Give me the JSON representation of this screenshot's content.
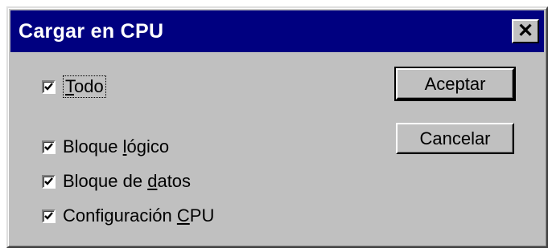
{
  "dialog": {
    "title": "Cargar en CPU",
    "close_symbol": "✕",
    "checkboxes": [
      {
        "label_pre": "",
        "label_key": "T",
        "label_post": "odo",
        "mnemonic": "T",
        "checked": true
      },
      {
        "label_pre": "Bloque ",
        "label_key": "l",
        "label_post": "ógico",
        "mnemonic": "l",
        "checked": true
      },
      {
        "label_pre": "Bloque de ",
        "label_key": "d",
        "label_post": "atos",
        "mnemonic": "d",
        "checked": true
      },
      {
        "label_pre": "Configuración ",
        "label_key": "C",
        "label_post": "PU",
        "mnemonic": "C",
        "checked": true
      }
    ],
    "buttons": {
      "accept": "Aceptar",
      "cancel": "Cancelar"
    }
  },
  "colors": {
    "title_bar": "#000080",
    "face": "#c0c0c0"
  }
}
